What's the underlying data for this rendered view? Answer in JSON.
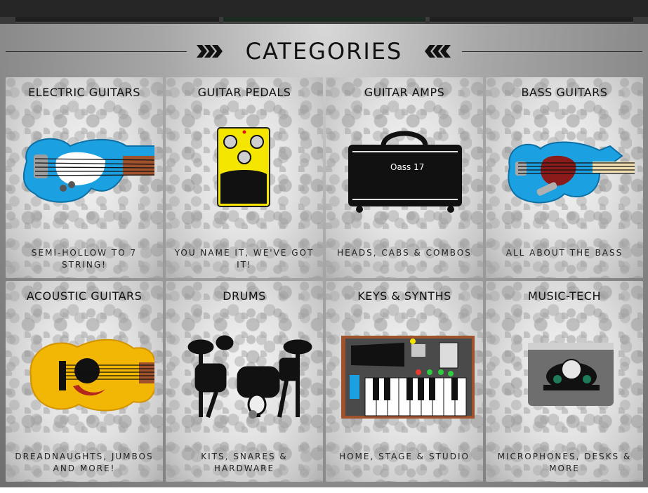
{
  "section": {
    "title": "CATEGORIES",
    "left_decoration_icon": "triple-chevron-right-icon",
    "right_decoration_icon": "triple-chevron-left-icon"
  },
  "categories": [
    {
      "title": "ELECTRIC GUITARS",
      "subtitle": "SEMI-HOLLOW TO 7 STRING!",
      "icon": "electric-guitar-icon"
    },
    {
      "title": "GUITAR PEDALS",
      "subtitle": "YOU NAME IT, WE'VE GOT IT!",
      "icon": "guitar-pedal-icon"
    },
    {
      "title": "GUITAR AMPS",
      "subtitle": "HEADS, CABS & COMBOS",
      "icon": "guitar-amp-icon",
      "amp_badge": "Oass 17"
    },
    {
      "title": "BASS GUITARS",
      "subtitle": "ALL ABOUT THE BASS",
      "icon": "bass-guitar-icon"
    },
    {
      "title": "ACOUSTIC GUITARS",
      "subtitle": "DREADNAUGHTS, JUMBOS AND MORE!",
      "icon": "acoustic-guitar-icon"
    },
    {
      "title": "DRUMS",
      "subtitle": "KITS, SNARES & HARDWARE",
      "icon": "drum-kit-icon"
    },
    {
      "title": "KEYS & SYNTHS",
      "subtitle": "HOME, STAGE & STUDIO",
      "icon": "synth-keyboard-icon"
    },
    {
      "title": "MUSIC-TECH",
      "subtitle": "MICROPHONES, DESKS & MORE",
      "icon": "audio-interface-icon"
    }
  ],
  "colors": {
    "topbar": "#262626",
    "electric_guitar_body": "#1ba1e2",
    "pedal_yellow": "#f5e600",
    "acoustic_body": "#f2b705",
    "bass_pickguard": "#8b1a1a"
  }
}
